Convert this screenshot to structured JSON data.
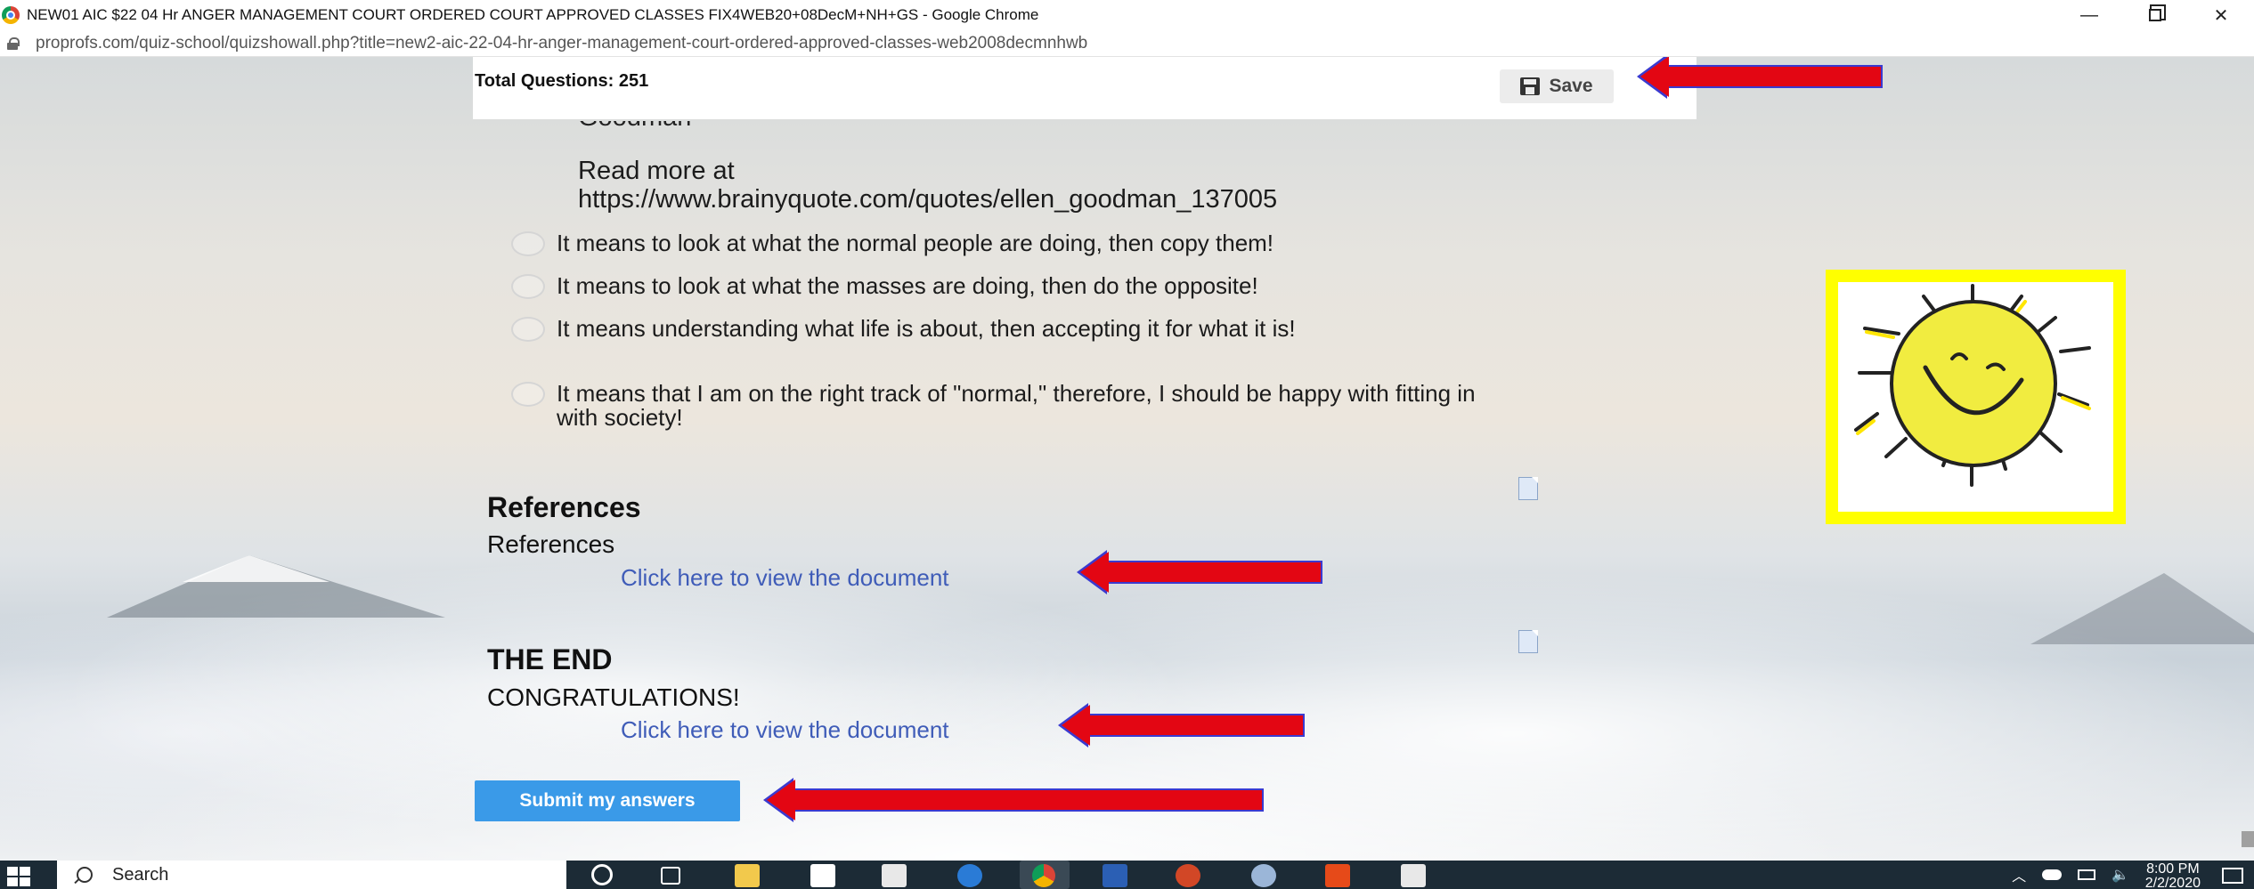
{
  "window": {
    "title": "NEW01 AIC $22 04 Hr ANGER MANAGEMENT COURT ORDERED COURT APPROVED CLASSES FIX4WEB20+08DecM+NH+GS - Google Chrome",
    "minimize": "—",
    "close": "✕"
  },
  "address": {
    "url": "proprofs.com/quiz-school/quizshowall.php?title=new2-aic-22-04-hr-anger-management-court-ordered-approved-classes-web2008decmnhwb"
  },
  "quiz": {
    "total_questions": "Total Questions: 251",
    "save_label": "Save",
    "quote_tail": "Goodman",
    "read_more_line1": "Read more at",
    "read_more_line2": "https://www.brainyquote.com/quotes/ellen_goodman_137005",
    "options": [
      "It means to look at what the normal people are doing, then copy them!",
      "It means to look at what the masses are doing, then do the opposite!",
      "It means understanding what life is about, then accepting it for what it is!",
      "It means that I am on the right track of \"normal,\" therefore, I should be happy with fitting in with society!"
    ],
    "references_heading": "References",
    "references_text": "References",
    "view_document_link_1": "Click here to view the document",
    "end_heading": "THE END",
    "congratulations": "CONGRATULATIONS!",
    "view_document_link_2": "Click here to view the document",
    "submit_label": "Submit my answers"
  },
  "taskbar": {
    "search_label": "Search",
    "time": "8:00 PM",
    "date": "2/2/2020"
  },
  "colors": {
    "arrow_red": "#e30613",
    "arrow_outline": "#3a3ad0",
    "submit_blue": "#3a9ae8",
    "link_blue": "#3f5cb8",
    "sun_frame_yellow": "#ffff00"
  }
}
